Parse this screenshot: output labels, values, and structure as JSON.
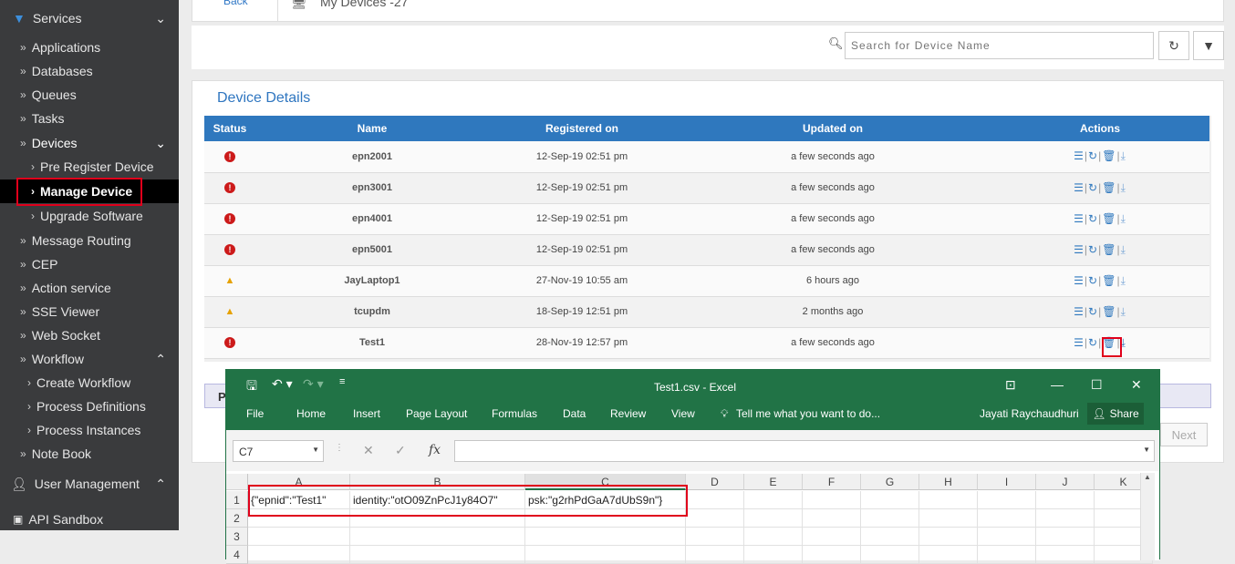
{
  "sidebar": {
    "services_label": "Services",
    "items": [
      {
        "label": "Applications"
      },
      {
        "label": "Databases"
      },
      {
        "label": "Queues"
      },
      {
        "label": "Tasks"
      }
    ],
    "devices_label": "Devices",
    "device_items": [
      {
        "label": "Pre Register Device"
      },
      {
        "label": "Manage Device"
      },
      {
        "label": "Upgrade Software"
      }
    ],
    "items2": [
      {
        "label": "Message Routing"
      },
      {
        "label": "CEP"
      },
      {
        "label": "Action service"
      },
      {
        "label": "SSE Viewer"
      },
      {
        "label": "Web Socket"
      }
    ],
    "workflow_label": "Workflow",
    "workflow_items": [
      {
        "label": "Create Workflow"
      },
      {
        "label": "Process Definitions"
      },
      {
        "label": "Process Instances"
      }
    ],
    "notebook_label": "Note Book",
    "user_mgmt_label": "User Management",
    "api_sandbox_label": "API Sandbox"
  },
  "topbar": {
    "back_label": "Back",
    "title": "My Devices -27"
  },
  "search": {
    "placeholder": "Search for Device Name"
  },
  "panel": {
    "title": "Device Details",
    "columns": [
      "Status",
      "Name",
      "Registered on",
      "Updated on",
      "Actions"
    ],
    "rows": [
      {
        "status": "error",
        "name": "epn2001",
        "registered": "12-Sep-19 02:51 pm",
        "updated": "a few seconds ago"
      },
      {
        "status": "error",
        "name": "epn3001",
        "registered": "12-Sep-19 02:51 pm",
        "updated": "a few seconds ago"
      },
      {
        "status": "error",
        "name": "epn4001",
        "registered": "12-Sep-19 02:51 pm",
        "updated": "a few seconds ago"
      },
      {
        "status": "error",
        "name": "epn5001",
        "registered": "12-Sep-19 02:51 pm",
        "updated": "a few seconds ago"
      },
      {
        "status": "warning",
        "name": "JayLaptop1",
        "registered": "27-Nov-19 10:55 am",
        "updated": "6 hours ago"
      },
      {
        "status": "warning",
        "name": "tcupdm",
        "registered": "18-Sep-19 12:51 pm",
        "updated": "2 months ago"
      },
      {
        "status": "error",
        "name": "Test1",
        "registered": "28-Nov-19 12:57 pm",
        "updated": "a few seconds ago"
      }
    ],
    "pbar_label": "P",
    "next_label": "Next"
  },
  "excel": {
    "title": "Test1.csv - Excel",
    "menu": [
      "File",
      "Home",
      "Insert",
      "Page Layout",
      "Formulas",
      "Data",
      "Review",
      "View"
    ],
    "tell_me": "Tell me what you want to do...",
    "user": "Jayati  Raychaudhuri",
    "share": "Share",
    "namebox": "C7",
    "columns": [
      "A",
      "B",
      "C",
      "D",
      "E",
      "F",
      "G",
      "H",
      "I",
      "J",
      "K"
    ],
    "rows": [
      "1",
      "2",
      "3",
      "4"
    ],
    "cells": {
      "A1": "{\"epnid\":\"Test1\"",
      "B1": "identity:\"otO09ZnPcJ1y84O7\"",
      "C1": "psk:\"g2rhPdGaA7dUbS9n\"}"
    }
  },
  "colors": {
    "sidebar_bg": "#3a3b3d",
    "table_header": "#2f78be",
    "excel_green": "#217346",
    "highlight": "#e0001b"
  }
}
